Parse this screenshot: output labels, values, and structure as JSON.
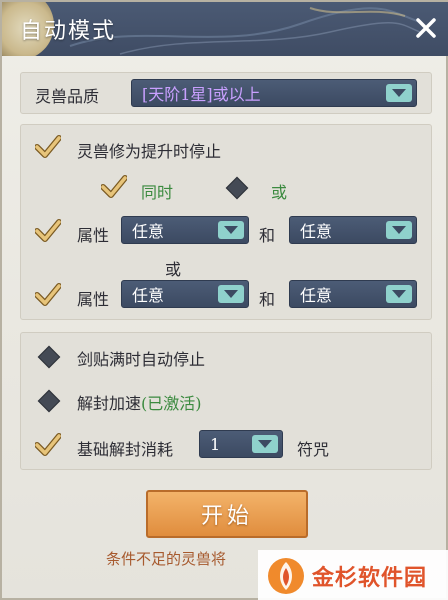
{
  "header": {
    "title": "自动模式"
  },
  "quality": {
    "label": "灵兽品质",
    "value": "[天阶1星]或以上",
    "value_color": "#c9a0ff"
  },
  "upgrade": {
    "stop_label": "灵兽修为提升时停止",
    "mode_and": "同时",
    "mode_or": "或",
    "attr_label": "属性",
    "and_label": "和",
    "between_or": "或",
    "row1": {
      "first": "任意",
      "second": "任意"
    },
    "row2": {
      "first": "任意",
      "second": "任意"
    }
  },
  "options": {
    "sword_stop": "剑贴满时自动停止",
    "unseal_speed": "解封加速",
    "unseal_speed_status": "(已激活)",
    "base_cost_label": "基础解封消耗",
    "base_cost_value": "1",
    "base_cost_unit": "符咒"
  },
  "actions": {
    "start": "开始"
  },
  "footer": {
    "note": "条件不足的灵兽将"
  },
  "watermark": {
    "text": "金杉软件园"
  },
  "colors": {
    "header_bg": "#44526b",
    "select_bg": "#44526b",
    "arrow_bg": "#8fd1cc",
    "start_bg": "#eea054",
    "accent_green": "#3b8a3f"
  },
  "icons": {
    "check": "gold-checkmark-icon",
    "unchecked": "dark-diamond-icon",
    "close": "close-x-icon",
    "dropdown": "chevron-down-icon"
  }
}
